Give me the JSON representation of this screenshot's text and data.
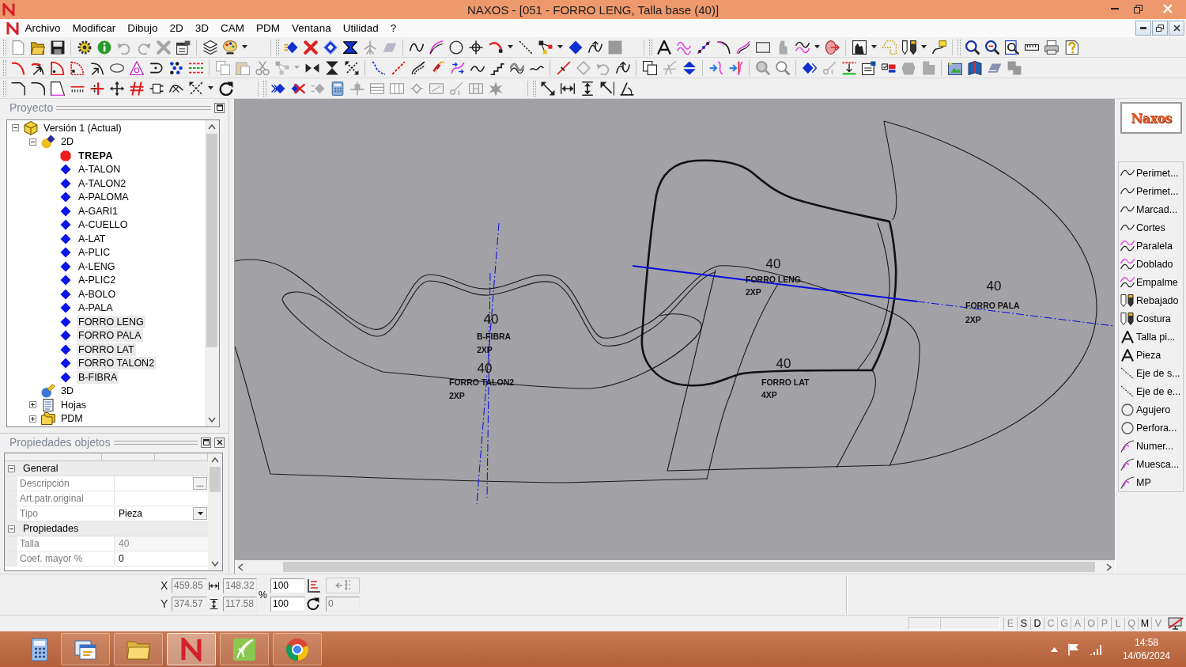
{
  "window": {
    "title": "NAXOS - [051 - FORRO LENG, Talla base (40)]"
  },
  "menu": [
    "Archivo",
    "Modificar",
    "Dibujo",
    "2D",
    "3D",
    "CAM",
    "PDM",
    "Ventana",
    "Utilidad",
    "?"
  ],
  "project_panel": {
    "title": "Proyecto",
    "tree": [
      {
        "label": "Versión 1 (Actual)",
        "kind": "version",
        "expanded": true,
        "selected": false,
        "children": [
          {
            "label": "2D",
            "kind": "plane",
            "expanded": true,
            "selected": false,
            "children": [
              {
                "label": "TREPA",
                "kind": "piece",
                "active": true,
                "selected": false
              },
              {
                "label": "A-TALON",
                "kind": "piece",
                "active": false,
                "selected": false
              },
              {
                "label": "A-TALON2",
                "kind": "piece",
                "active": false,
                "selected": false
              },
              {
                "label": "A-PALOMA",
                "kind": "piece",
                "active": false,
                "selected": false
              },
              {
                "label": "A-GARI1",
                "kind": "piece",
                "active": false,
                "selected": false
              },
              {
                "label": "A-CUELLO",
                "kind": "piece",
                "active": false,
                "selected": false
              },
              {
                "label": "A-LAT",
                "kind": "piece",
                "active": false,
                "selected": false
              },
              {
                "label": "A-PLIC",
                "kind": "piece",
                "active": false,
                "selected": false
              },
              {
                "label": "A-LENG",
                "kind": "piece",
                "active": false,
                "selected": false
              },
              {
                "label": "A-PLIC2",
                "kind": "piece",
                "active": false,
                "selected": false
              },
              {
                "label": "A-BOLO",
                "kind": "piece",
                "active": false,
                "selected": false
              },
              {
                "label": "A-PALA",
                "kind": "piece",
                "active": false,
                "selected": false
              },
              {
                "label": "FORRO LENG",
                "kind": "piece",
                "active": false,
                "selected": true
              },
              {
                "label": "FORRO PALA",
                "kind": "piece",
                "active": false,
                "selected": true
              },
              {
                "label": "FORRO LAT",
                "kind": "piece",
                "active": false,
                "selected": true
              },
              {
                "label": "FORRO TALON2",
                "kind": "piece",
                "active": false,
                "selected": true
              },
              {
                "label": "B-FIBRA",
                "kind": "piece",
                "active": false,
                "selected": true
              }
            ]
          },
          {
            "label": "3D",
            "kind": "solid",
            "selected": false
          },
          {
            "label": "Hojas",
            "kind": "sheets",
            "expanded": false,
            "selected": false
          },
          {
            "label": "PDM",
            "kind": "pdm",
            "expanded": false,
            "selected": false
          }
        ]
      }
    ]
  },
  "properties_panel": {
    "title": "Propiedades objetos",
    "sections": [
      {
        "title": "General",
        "expanded": true,
        "rows": [
          {
            "label": "Descripción",
            "kind": "ellipsis",
            "button": "...",
            "readonly": false
          },
          {
            "label": "Art.patr.original",
            "kind": "text",
            "readonly": false
          },
          {
            "label": "Tipo",
            "kind": "dropdown",
            "value": "Pieza",
            "readonly": false
          }
        ]
      },
      {
        "title": "Propiedades",
        "expanded": true,
        "rows": [
          {
            "label": "Talla",
            "kind": "text",
            "value": "40",
            "readonly": true
          },
          {
            "label": "Coef. mayor %",
            "kind": "text",
            "value": "0",
            "readonly": false
          }
        ]
      }
    ]
  },
  "canvas": {
    "labels": [
      {
        "size": "40",
        "name": "FORRO LENG",
        "quantity": "2XP"
      },
      {
        "size": "40",
        "name": "FORRO PALA",
        "quantity": "2XP"
      },
      {
        "size": "40",
        "name": "B-FIBRA",
        "quantity": "2XP"
      },
      {
        "size": "40",
        "name": "FORRO TALON2",
        "quantity": "2XP"
      },
      {
        "size": "40",
        "name": "FORRO LAT",
        "quantity": "4XP"
      }
    ]
  },
  "layers_panel": {
    "logo": "Naxos",
    "items": [
      {
        "label": "Perimet...",
        "kind": "curve"
      },
      {
        "label": "Perimet...",
        "kind": "curve"
      },
      {
        "label": "Marcad...",
        "kind": "curve"
      },
      {
        "label": "Cortes",
        "kind": "curve"
      },
      {
        "label": "Paralela",
        "kind": "double"
      },
      {
        "label": "Doblado",
        "kind": "double"
      },
      {
        "label": "Empalme",
        "kind": "double"
      },
      {
        "label": "Rebajado",
        "kind": "pencil"
      },
      {
        "label": "Costura",
        "kind": "pencil"
      },
      {
        "label": "Talla pi...",
        "kind": "letter"
      },
      {
        "label": "Pieza",
        "kind": "letter"
      },
      {
        "label": "Eje de s...",
        "kind": "axis"
      },
      {
        "label": "Eje de e...",
        "kind": "axis"
      },
      {
        "label": "Agujero",
        "kind": "hole"
      },
      {
        "label": "Perfora...",
        "kind": "hole"
      },
      {
        "label": "Numer...",
        "kind": "notch"
      },
      {
        "label": "Muesca...",
        "kind": "notch"
      },
      {
        "label": "MP",
        "kind": "notch"
      }
    ]
  },
  "coordinates": {
    "rows": [
      {
        "axis": "X",
        "position": {
          "value": "459.85",
          "disabled": true
        },
        "size": {
          "value": "148.32",
          "disabled": true
        },
        "scale": {
          "value": "100",
          "disabled": false
        }
      },
      {
        "axis": "Y",
        "position": {
          "value": "374.57",
          "disabled": true
        },
        "size": {
          "value": "117.58",
          "disabled": true
        },
        "scale": {
          "value": "100",
          "disabled": false
        }
      }
    ],
    "percent": "%",
    "action_button": {
      "disabled": true
    },
    "rotation": {
      "value": "0",
      "disabled": true
    }
  },
  "status_bar": {
    "flags": [
      {
        "label": "E",
        "on": false
      },
      {
        "label": "S",
        "on": true
      },
      {
        "label": "D",
        "on": true
      },
      {
        "label": "C",
        "on": false
      },
      {
        "label": "G",
        "on": false
      },
      {
        "label": "A",
        "on": false
      },
      {
        "label": "O",
        "on": false
      },
      {
        "label": "P",
        "on": false
      },
      {
        "label": "L",
        "on": false
      },
      {
        "label": "Q",
        "on": false
      },
      {
        "label": "M",
        "on": true
      },
      {
        "label": "V",
        "on": false
      }
    ]
  },
  "taskbar": {
    "apps": [
      {
        "running": false,
        "selected": false
      },
      {
        "running": true,
        "selected": false
      },
      {
        "running": true,
        "selected": false
      },
      {
        "running": true,
        "selected": true
      },
      {
        "running": true,
        "selected": false
      },
      {
        "running": true,
        "selected": false
      }
    ],
    "time": "14:58",
    "date": "14/06/2024"
  }
}
